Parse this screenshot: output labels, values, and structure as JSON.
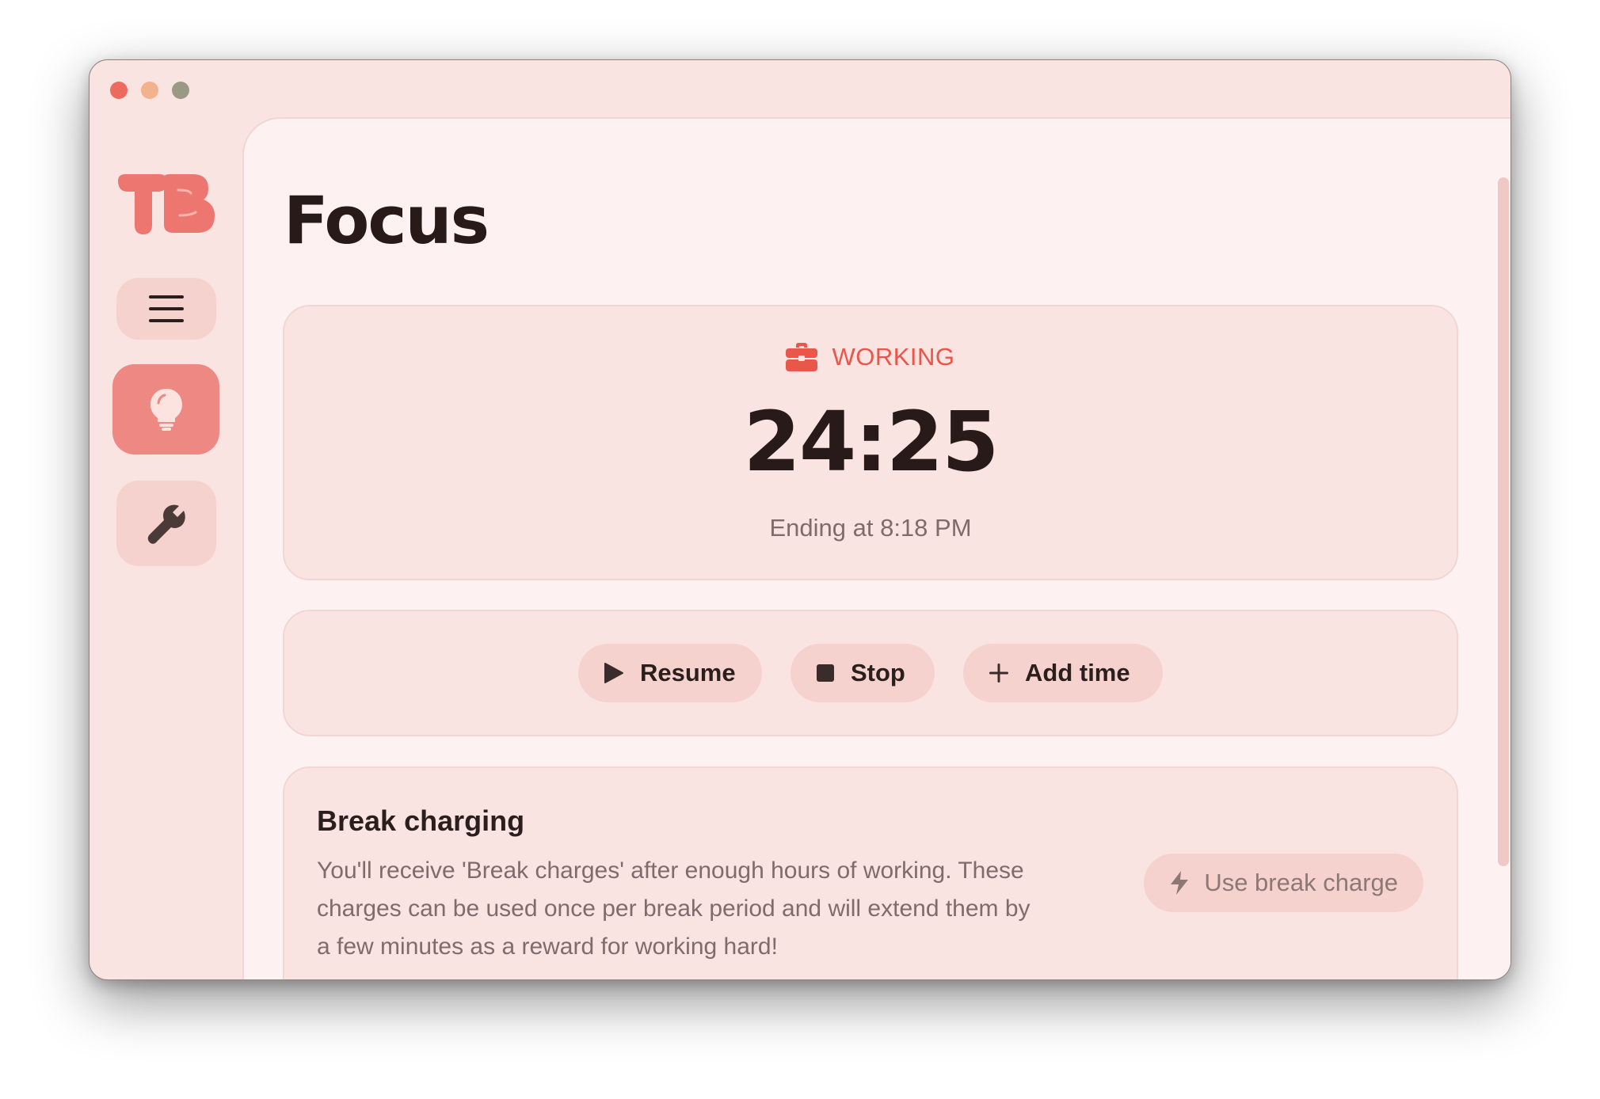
{
  "window": {
    "controls": [
      "close",
      "minimize",
      "maximize"
    ]
  },
  "sidebar": {
    "logo_text": "TB",
    "items": [
      {
        "name": "menu",
        "icon": "hamburger-icon",
        "active": false
      },
      {
        "name": "focus",
        "icon": "lightbulb-icon",
        "active": true
      },
      {
        "name": "tools",
        "icon": "wrench-icon",
        "active": false
      }
    ]
  },
  "page": {
    "title": "Focus"
  },
  "timer": {
    "status_icon": "briefcase-icon",
    "status": "WORKING",
    "time": "24:25",
    "ending": "Ending at 8:18 PM"
  },
  "controls": {
    "resume": "Resume",
    "stop": "Stop",
    "add_time": "Add time"
  },
  "break_charging": {
    "title": "Break charging",
    "description": "You'll receive 'Break charges' after enough hours of working. These charges can be used once per break period and will extend them by a few minutes as a reward for working hard!",
    "button": "Use break charge",
    "button_icon": "bolt-icon"
  },
  "colors": {
    "accent": "#e9564a",
    "active_nav": "#ee8883",
    "background": "#f9e4e2"
  }
}
